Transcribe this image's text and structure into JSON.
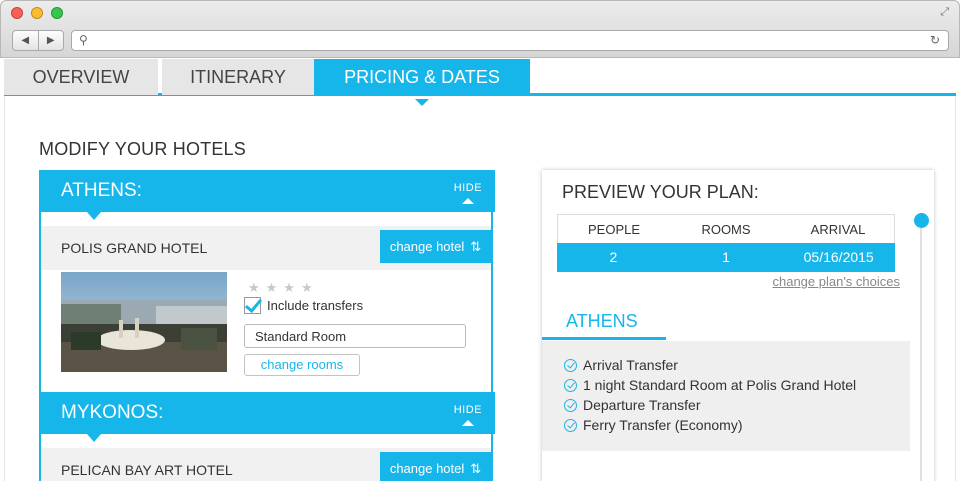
{
  "browser": {
    "window_controls": [
      "close",
      "minimize",
      "zoom"
    ],
    "back_label": "◀",
    "forward_label": "▶",
    "search_icon": "search-icon",
    "reload_icon": "reload-icon",
    "url": ""
  },
  "tabs": [
    {
      "label": "OVERVIEW",
      "active": false
    },
    {
      "label": "ITINERARY",
      "active": false
    },
    {
      "label": "PRICING & DATES",
      "active": true
    }
  ],
  "colors": {
    "accent": "#17b6ea",
    "panel_bg": "#f1f1f1"
  },
  "hotels_section": {
    "title": "MODIFY YOUR HOTELS",
    "cities": [
      {
        "name": "ATHENS:",
        "hide_label": "HIDE",
        "hotel_name": "POLIS GRAND HOTEL",
        "change_hotel_label": "change hotel",
        "stars": "★★★★",
        "include_transfers_label": "Include transfers",
        "include_transfers_checked": true,
        "room_type": "Standard Room",
        "change_rooms_label": "change rooms"
      },
      {
        "name": "MYKONOS:",
        "hide_label": "HIDE",
        "hotel_name": "PELICAN BAY ART HOTEL",
        "change_hotel_label": "change hotel"
      }
    ]
  },
  "preview": {
    "title": "PREVIEW YOUR PLAN:",
    "table": {
      "headers": [
        "PEOPLE",
        "ROOMS",
        "ARRIVAL"
      ],
      "values": [
        "2",
        "1",
        "05/16/2015"
      ]
    },
    "change_plan_label": "change plan's choices",
    "city_tab": "ATHENS",
    "items": [
      "Arrival Transfer",
      "1 night Standard Room at Polis Grand Hotel",
      "Departure Transfer",
      "Ferry Transfer (Economy)"
    ]
  }
}
